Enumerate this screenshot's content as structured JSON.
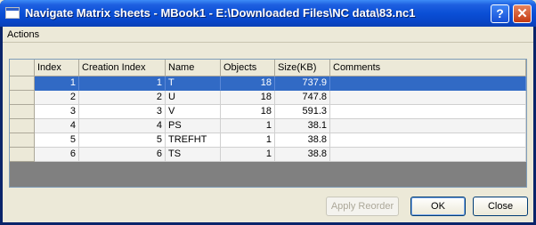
{
  "window": {
    "title": "Navigate Matrix sheets - MBook1 - E:\\Downloaded Files\\NC data\\83.nc1",
    "help_label": "?",
    "close_label": "✕"
  },
  "menu": {
    "actions_label": "Actions"
  },
  "table": {
    "columns": [
      "Index",
      "Creation Index",
      "Name",
      "Objects",
      "Size(KB)",
      "Comments"
    ],
    "rows": [
      {
        "index": "1",
        "creation_index": "1",
        "name": "T",
        "objects": "18",
        "size": "737.9",
        "comments": ""
      },
      {
        "index": "2",
        "creation_index": "2",
        "name": "U",
        "objects": "18",
        "size": "747.8",
        "comments": ""
      },
      {
        "index": "3",
        "creation_index": "3",
        "name": "V",
        "objects": "18",
        "size": "591.3",
        "comments": ""
      },
      {
        "index": "4",
        "creation_index": "4",
        "name": "PS",
        "objects": "1",
        "size": "38.1",
        "comments": ""
      },
      {
        "index": "5",
        "creation_index": "5",
        "name": "TREFHT",
        "objects": "1",
        "size": "38.8",
        "comments": ""
      },
      {
        "index": "6",
        "creation_index": "6",
        "name": "TS",
        "objects": "1",
        "size": "38.8",
        "comments": ""
      }
    ],
    "selected_row": 0,
    "selection_color": "#316ac5"
  },
  "buttons": {
    "apply_reorder": "Apply Reorder",
    "ok": "OK",
    "close": "Close"
  }
}
